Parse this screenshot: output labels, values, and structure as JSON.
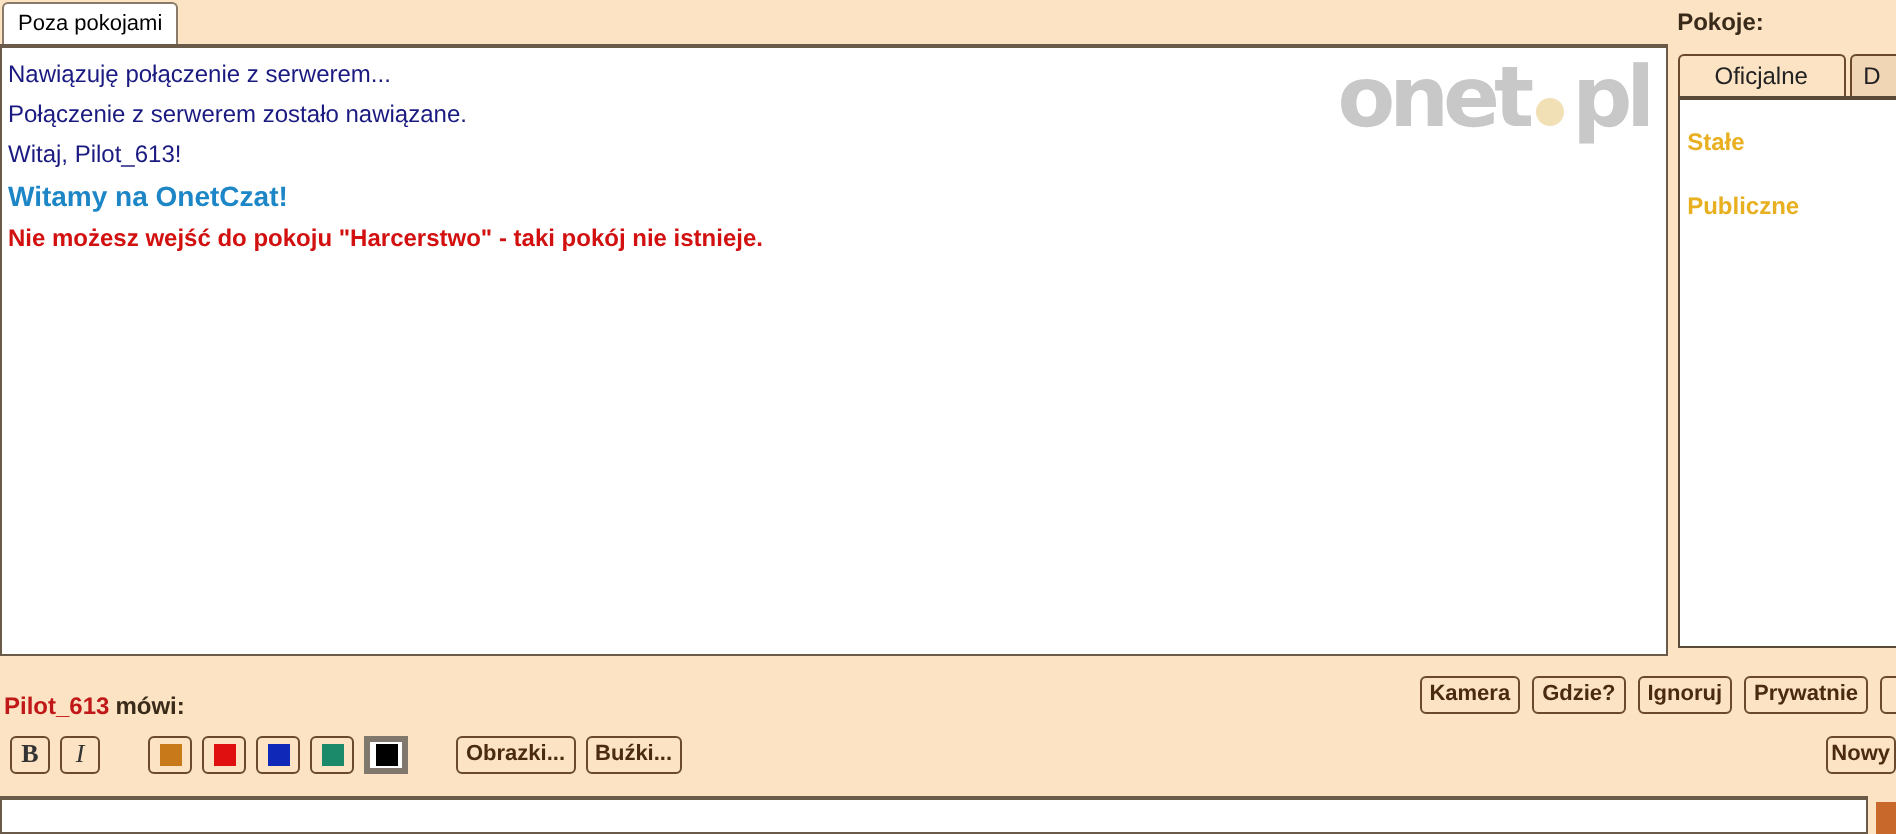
{
  "chat_tabs": [
    {
      "label": "Poza pokojami",
      "selected": true
    }
  ],
  "messages": [
    {
      "kind": "info",
      "text": "Nawiązuję połączenie z serwerem..."
    },
    {
      "kind": "info",
      "text": "Połączenie z serwerem zostało nawiązane."
    },
    {
      "kind": "info",
      "text": "Witaj, Pilot_613!"
    },
    {
      "kind": "welcome",
      "text": "Witamy na OnetCzat!"
    },
    {
      "kind": "error",
      "text": "Nie możesz wejść do pokoju \"Harcerstwo\" - taki pokój nie istnieje."
    }
  ],
  "logo": {
    "left": "onet",
    "right": "pl"
  },
  "rooms": {
    "title": "Pokoje:",
    "tabs": [
      {
        "label": "Oficjalne",
        "selected": true
      },
      {
        "label": "D",
        "selected": false
      }
    ],
    "categories": [
      "Stałe",
      "Publiczne"
    ]
  },
  "speaker": {
    "nick": "Pilot_613",
    "verb": "mówi:"
  },
  "user_buttons": [
    "Kamera",
    "Gdzie?",
    "Ignoruj",
    "Prywatnie"
  ],
  "format_buttons": [
    {
      "kind": "bold",
      "label": "B"
    },
    {
      "kind": "italic",
      "label": "I"
    }
  ],
  "colors": [
    {
      "color": "#c87a1a",
      "selected": false
    },
    {
      "color": "#e01010",
      "selected": false
    },
    {
      "color": "#1028b8",
      "selected": false
    },
    {
      "color": "#1a8a6a",
      "selected": false
    },
    {
      "color": "#000000",
      "selected": true
    }
  ],
  "extra_buttons": [
    "Obrazki...",
    "Buźki..."
  ],
  "new_button": "Nowy"
}
